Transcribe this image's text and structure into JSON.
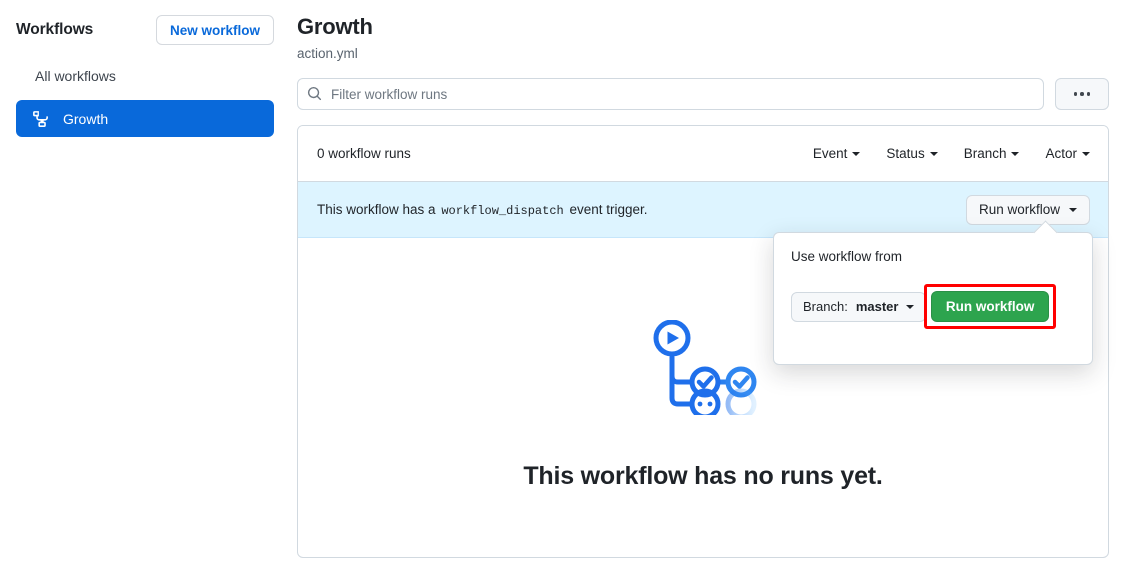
{
  "sidebar": {
    "title": "Workflows",
    "new_workflow_label": "New workflow",
    "items": [
      {
        "label": "All workflows",
        "icon": "",
        "selected": false
      },
      {
        "label": "Growth",
        "icon": "workflow-icon",
        "selected": true
      }
    ]
  },
  "main": {
    "title": "Growth",
    "subtitle": "action.yml",
    "search": {
      "placeholder": "Filter workflow runs",
      "value": "",
      "icon": "search-icon"
    },
    "kebab_label": "...",
    "runs": {
      "count_label": "0 workflow runs",
      "filters": [
        {
          "label": "Event"
        },
        {
          "label": "Status"
        },
        {
          "label": "Branch"
        },
        {
          "label": "Actor"
        }
      ]
    },
    "dispatch_banner": {
      "text_before": "This workflow has a",
      "code": "workflow_dispatch",
      "text_after": "event trigger.",
      "run_button_label": "Run workflow"
    },
    "empty_state": {
      "icon": "workflow-runs-illustration",
      "title": "This workflow has no runs yet."
    }
  },
  "popup": {
    "label": "Use workflow from",
    "branch_label": "Branch:",
    "branch_value": "master",
    "submit_label": "Run workflow"
  },
  "colors": {
    "accent_blue": "#0969da",
    "banner_blue": "#ddf4ff",
    "green": "#2da44e",
    "highlight_red": "#ff0000",
    "border": "#d1d9e0",
    "muted_text": "#59636e"
  }
}
